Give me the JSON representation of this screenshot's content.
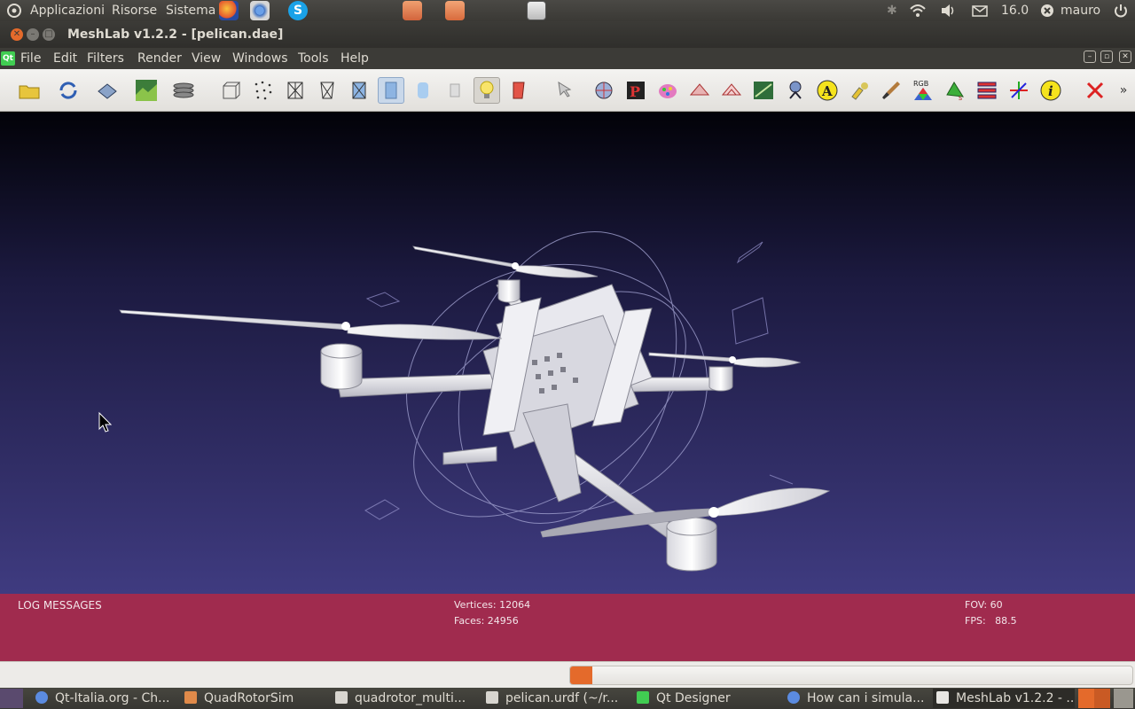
{
  "top_panel": {
    "menus": [
      "Applicazioni",
      "Risorse",
      "Sistema"
    ],
    "clock": "16.0",
    "user": "mauro"
  },
  "window": {
    "title": "MeshLab v1.2.2 - [pelican.dae]"
  },
  "menubar": {
    "qt_logo": "Qt",
    "items": [
      "File",
      "Edit",
      "Filters",
      "Render",
      "View",
      "Windows",
      "Tools",
      "Help"
    ]
  },
  "toolbar": {
    "rgb_label": "RGB",
    "overflow": "»",
    "icons": [
      "open-folder",
      "reload",
      "save",
      "snapshot",
      "layers",
      "bbox",
      "points",
      "wireframe",
      "hidden-lines",
      "flat-lines",
      "flat",
      "smooth",
      "texture",
      "lighting",
      "double-side",
      "select-faces",
      "pick-points",
      "pdf-export",
      "paint",
      "measure",
      "edit-align",
      "texture-param",
      "manipulator",
      "annotate",
      "sample",
      "paint-brush",
      "rgb-color",
      "shading",
      "stratum",
      "axes",
      "info",
      "close-x"
    ]
  },
  "infobar": {
    "log_title": "LOG MESSAGES",
    "vertices": "Vertices: 12064",
    "faces": "Faces: 24956",
    "fov": "FOV: 60",
    "fps": "FPS:   88.5"
  },
  "status": {
    "progress": 0.005
  },
  "taskbar": {
    "tasks": [
      "Qt-Italia.org - Ch...",
      "QuadRotorSim",
      "quadrotor_multi...",
      "pelican.urdf (~/r...",
      "Qt Designer",
      "How can i simula...",
      "MeshLab v1.2.2 - ..."
    ]
  },
  "colors": {
    "info_bar": "#a02b4e",
    "viewport_top": "#020208",
    "viewport_bottom": "#3f3b80",
    "close_button": "#e46a2b"
  }
}
